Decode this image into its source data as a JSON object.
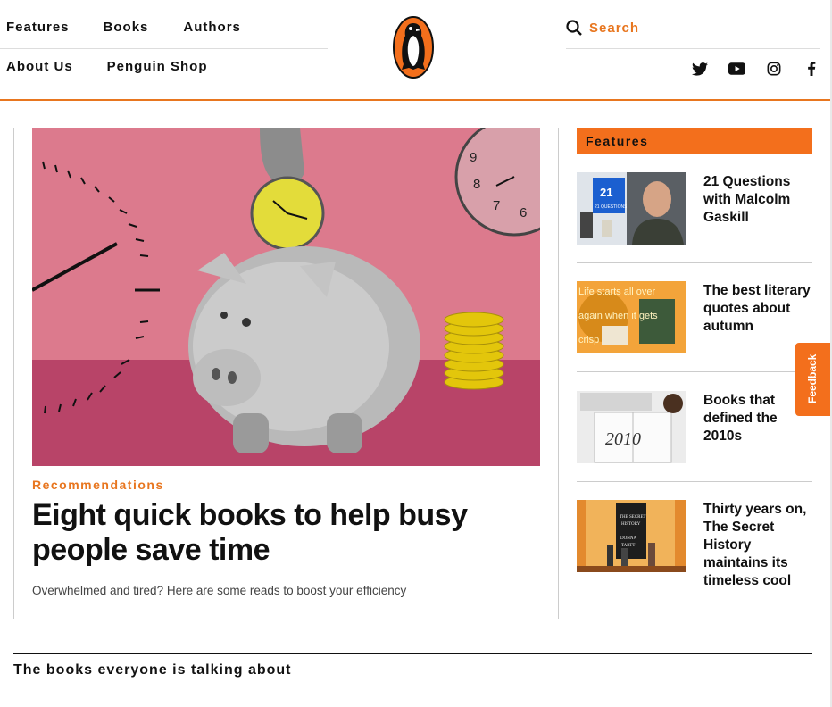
{
  "nav": {
    "row1": [
      "Features",
      "Books",
      "Authors"
    ],
    "row2": [
      "About Us",
      "Penguin Shop"
    ]
  },
  "search": {
    "label": "Search",
    "icon": "search-icon"
  },
  "socials": [
    "twitter-icon",
    "youtube-icon",
    "instagram-icon",
    "facebook-icon"
  ],
  "brand": {
    "accent": "#f36f1c",
    "text": "#111111"
  },
  "hero": {
    "category": "Recommendations",
    "title": "Eight quick books to help busy people save time",
    "standfirst": "Overwhelmed and tired? Here are some reads to boost your efficiency"
  },
  "sidebar": {
    "heading": "Features",
    "items": [
      {
        "title": "21 Questions with Malcolm Gaskill",
        "thumb_text": "21 QUESTIONS"
      },
      {
        "title": "The best literary quotes about autumn",
        "thumb_text": "Life starts all over again when it gets crisp"
      },
      {
        "title": "Books that defined the 2010s",
        "thumb_text": "2010"
      },
      {
        "title": "Thirty years on, The Secret History maintains its timeless cool",
        "thumb_text": "THE SECRET HISTORY DONNA TARTT"
      }
    ]
  },
  "feedback": {
    "label": "Feedback"
  },
  "section": {
    "title": "The books everyone is talking about"
  }
}
